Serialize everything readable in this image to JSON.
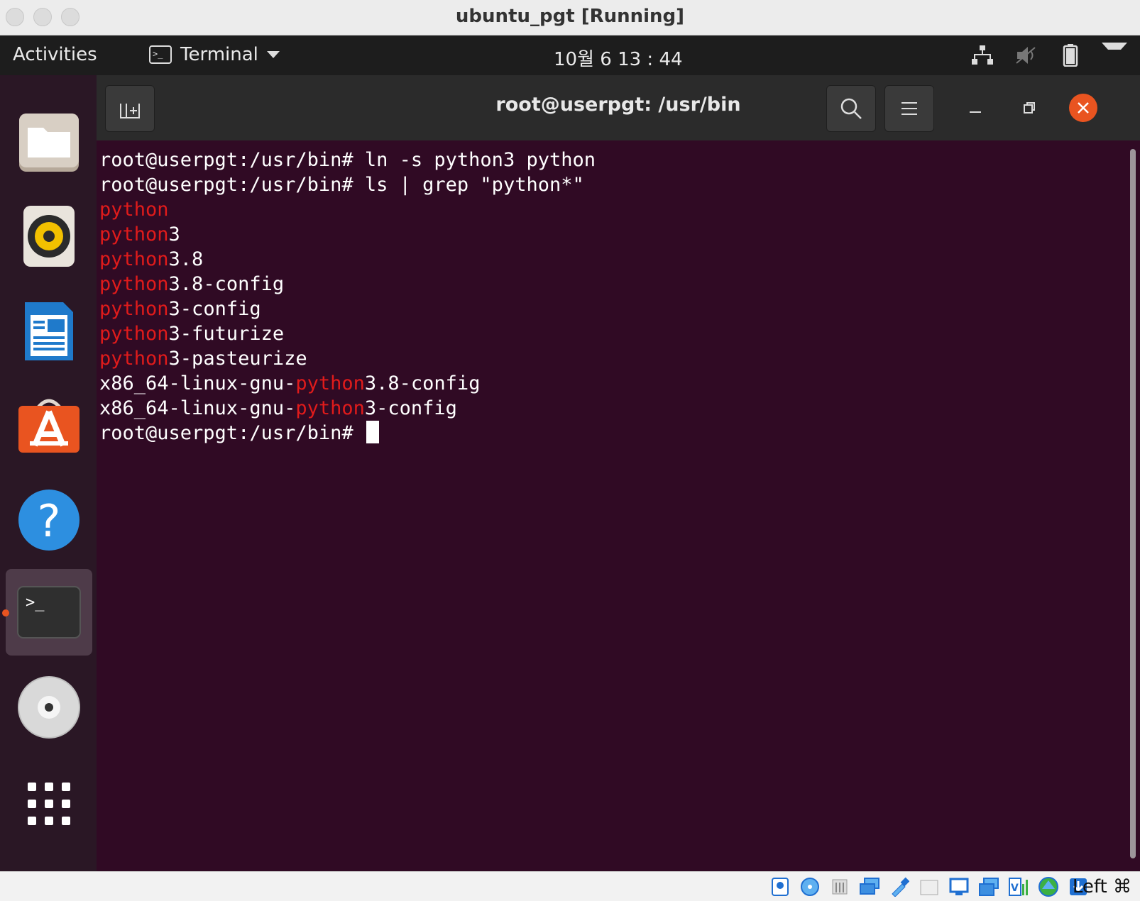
{
  "host_window": {
    "title": "ubuntu_pgt [Running]",
    "host_key": "Left ⌘"
  },
  "topbar": {
    "activities": "Activities",
    "app_menu": "Terminal",
    "clock": "10월 6  13 : 44"
  },
  "dock": {
    "items": [
      "files-icon",
      "rhythmbox-icon",
      "libreoffice-writer-icon",
      "ubuntu-software-icon",
      "help-icon",
      "terminal-icon",
      "dvd-icon",
      "show-apps-icon"
    ],
    "active_item": "terminal-icon"
  },
  "terminal": {
    "title": "root@userpgt: /usr/bin",
    "lines": [
      {
        "segments": [
          {
            "text": "root@userpgt:/usr/bin# ln -s python3 python",
            "hl": false
          }
        ]
      },
      {
        "segments": [
          {
            "text": "root@userpgt:/usr/bin# ls | grep \"python*\"",
            "hl": false
          }
        ]
      },
      {
        "segments": [
          {
            "text": "python",
            "hl": true
          }
        ]
      },
      {
        "segments": [
          {
            "text": "python",
            "hl": true
          },
          {
            "text": "3",
            "hl": false
          }
        ]
      },
      {
        "segments": [
          {
            "text": "python",
            "hl": true
          },
          {
            "text": "3.8",
            "hl": false
          }
        ]
      },
      {
        "segments": [
          {
            "text": "python",
            "hl": true
          },
          {
            "text": "3.8-config",
            "hl": false
          }
        ]
      },
      {
        "segments": [
          {
            "text": "python",
            "hl": true
          },
          {
            "text": "3-config",
            "hl": false
          }
        ]
      },
      {
        "segments": [
          {
            "text": "python",
            "hl": true
          },
          {
            "text": "3-futurize",
            "hl": false
          }
        ]
      },
      {
        "segments": [
          {
            "text": "python",
            "hl": true
          },
          {
            "text": "3-pasteurize",
            "hl": false
          }
        ]
      },
      {
        "segments": [
          {
            "text": "x86_64-linux-gnu-",
            "hl": false
          },
          {
            "text": "python",
            "hl": true
          },
          {
            "text": "3.8-config",
            "hl": false
          }
        ]
      },
      {
        "segments": [
          {
            "text": "x86_64-linux-gnu-",
            "hl": false
          },
          {
            "text": "python",
            "hl": true
          },
          {
            "text": "3-config",
            "hl": false
          }
        ]
      },
      {
        "segments": [
          {
            "text": "root@userpgt:/usr/bin# ",
            "hl": false
          }
        ],
        "cursor": true
      }
    ]
  },
  "colors": {
    "terminal_bg": "#300a24",
    "highlight": "#e01b1b",
    "accent": "#e95420"
  }
}
